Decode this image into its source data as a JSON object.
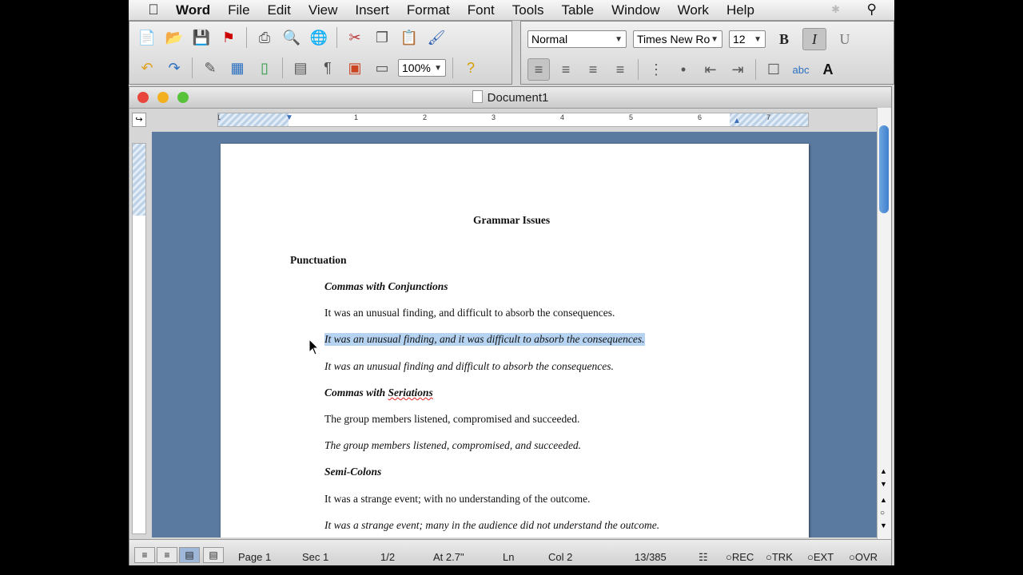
{
  "menubar": {
    "app": "Word",
    "items": [
      "File",
      "Edit",
      "View",
      "Insert",
      "Format",
      "Font",
      "Tools",
      "Table",
      "Window",
      "Work",
      "Help"
    ]
  },
  "toolbar": {
    "style": "Normal",
    "font": "Times New Ro",
    "size": "12",
    "zoom": "100%",
    "bold": "B",
    "italic": "I",
    "underline": "U"
  },
  "window": {
    "title": "Document1"
  },
  "ruler": {
    "numbers": [
      "1",
      "1",
      "2",
      "3",
      "4",
      "5",
      "6",
      "7"
    ]
  },
  "document": {
    "title": "Grammar Issues",
    "section": "Punctuation",
    "h1": "Commas with Conjunctions",
    "p1": "It was an unusual finding, and difficult to absorb the consequences.",
    "p2": "It was an unusual finding, and it was difficult to absorb the consequences.",
    "p3": "It was an unusual finding and difficult to absorb the consequences.",
    "h2_prefix": "Commas with ",
    "h2_word": "Seriations",
    "p4": "The group members listened, compromised and succeeded.",
    "p5": "The group members listened, compromised, and succeeded.",
    "h3": "Semi-Colons",
    "p6": "It was a strange event; with no understanding of the outcome.",
    "p7": "It was a strange event; many in the audience did not understand the outcome."
  },
  "status": {
    "page": "Page 1",
    "sec": "Sec 1",
    "pages": "1/2",
    "at": "At 2.7\"",
    "ln": "Ln",
    "col": "Col 2",
    "words": "13/385",
    "rec": "REC",
    "trk": "TRK",
    "ext": "EXT",
    "ovr": "OVR"
  },
  "colors": {
    "page_bg": "#5b7aa0",
    "selection": "#b6d4f2"
  }
}
